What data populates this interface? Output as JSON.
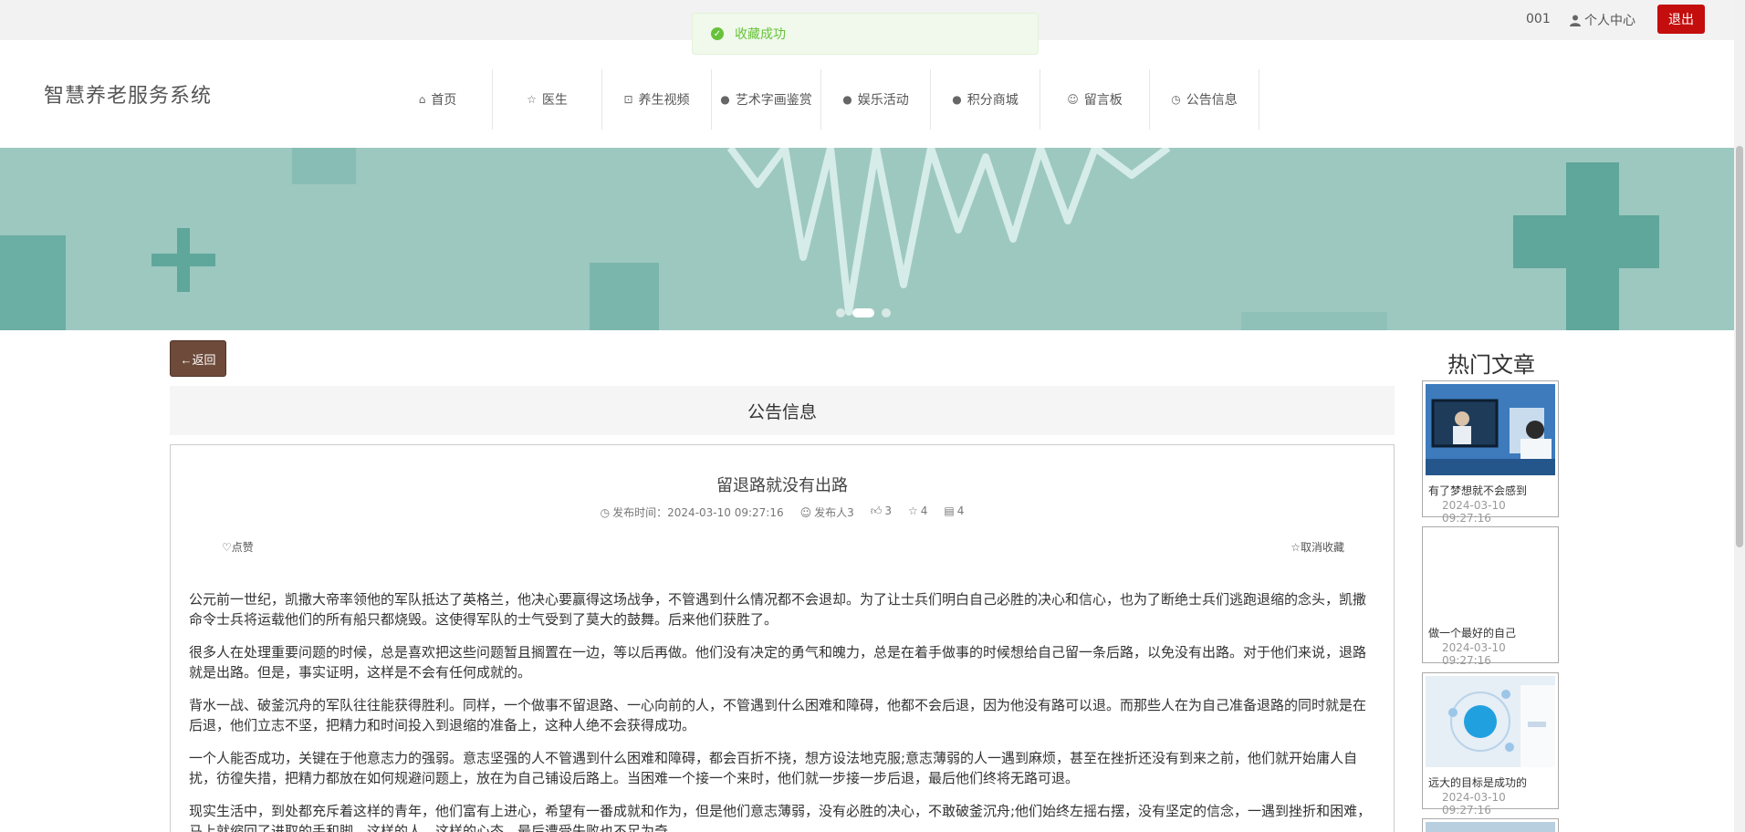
{
  "topbar": {
    "user": "001",
    "personal_center": "个人中心",
    "logout": "退出"
  },
  "toast": {
    "message": "收藏成功"
  },
  "header": {
    "logo": "智慧养老服务系统",
    "nav": [
      {
        "label": "首页",
        "icon": "home-icon"
      },
      {
        "label": "医生",
        "icon": "star-icon"
      },
      {
        "label": "养生视频",
        "icon": "bag-icon"
      },
      {
        "label": "艺术字画鉴赏",
        "icon": "info-icon"
      },
      {
        "label": "娱乐活动",
        "icon": "question-icon"
      },
      {
        "label": "积分商城",
        "icon": "info-icon"
      },
      {
        "label": "留言板",
        "icon": "smile-icon"
      },
      {
        "label": "公告信息",
        "icon": "clock-icon"
      }
    ]
  },
  "banner": {
    "active_slide": 2,
    "slide_count": 3,
    "color": "#9dc8bf"
  },
  "back_button": "←返回",
  "section_title": "公告信息",
  "article": {
    "title": "留退路就没有出路",
    "publish_label": "发布时间：",
    "publish_time": "2024-03-10 09:27:16",
    "publisher": "发布人3",
    "likes": "3",
    "favorites": "4",
    "comments": "4",
    "like_label": "点赞",
    "unfavorite_label": "取消收藏",
    "paragraphs": [
      "公元前一世纪，凯撒大帝率领他的军队抵达了英格兰，他决心要赢得这场战争，不管遇到什么情况都不会退却。为了让士兵们明白自己必胜的决心和信心，也为了断绝士兵们逃跑退缩的念头，凯撒命令士兵将运载他们的所有船只都烧毁。这使得军队的士气受到了莫大的鼓舞。后来他们获胜了。",
      "很多人在处理重要问题的时候，总是喜欢把这些问题暂且搁置在一边，等以后再做。他们没有决定的勇气和魄力，总是在着手做事的时候想给自己留一条后路，以免没有出路。对于他们来说，退路就是出路。但是，事实证明，这样是不会有任何成就的。",
      "背水一战、破釜沉舟的军队往往能获得胜利。同样，一个做事不留退路、一心向前的人，不管遇到什么困难和障碍，他都不会后退，因为他没有路可以退。而那些人在为自己准备退路的同时就是在后退，他们立志不坚，把精力和时间投入到退缩的准备上，这种人绝不会获得成功。",
      "一个人能否成功，关键在于他意志力的强弱。意志坚强的人不管遇到什么困难和障碍，都会百折不挠，想方设法地克服;意志薄弱的人一遇到麻烦，甚至在挫折还没有到来之前，他们就开始庸人自扰，彷徨失措，把精力都放在如何规避问题上，放在为自己铺设后路上。当困难一个接一个来时，他们就一步接一步后退，最后他们终将无路可退。",
      "现实生活中，到处都充斥着这样的青年，他们富有上进心，希望有一番成就和作为，但是他们意志薄弱，没有必胜的决心，不敢破釜沉舟;他们始终左摇右摆，没有坚定的信念，一遇到挫折和困难，马上就缩回了进取的手和脚，这样的人，这样的心态，最后遭受失败也不足为奇。"
    ]
  },
  "sidebar": {
    "title": "热门文章",
    "cards": [
      {
        "title": "有了梦想就不会感到",
        "date": "2024-03-10 09:27:16"
      },
      {
        "title": "做一个最好的自己",
        "date": "2024-03-10 09:27:16"
      },
      {
        "title": "远大的目标是成功的",
        "date": "2024-03-10 09:27:16"
      }
    ]
  }
}
